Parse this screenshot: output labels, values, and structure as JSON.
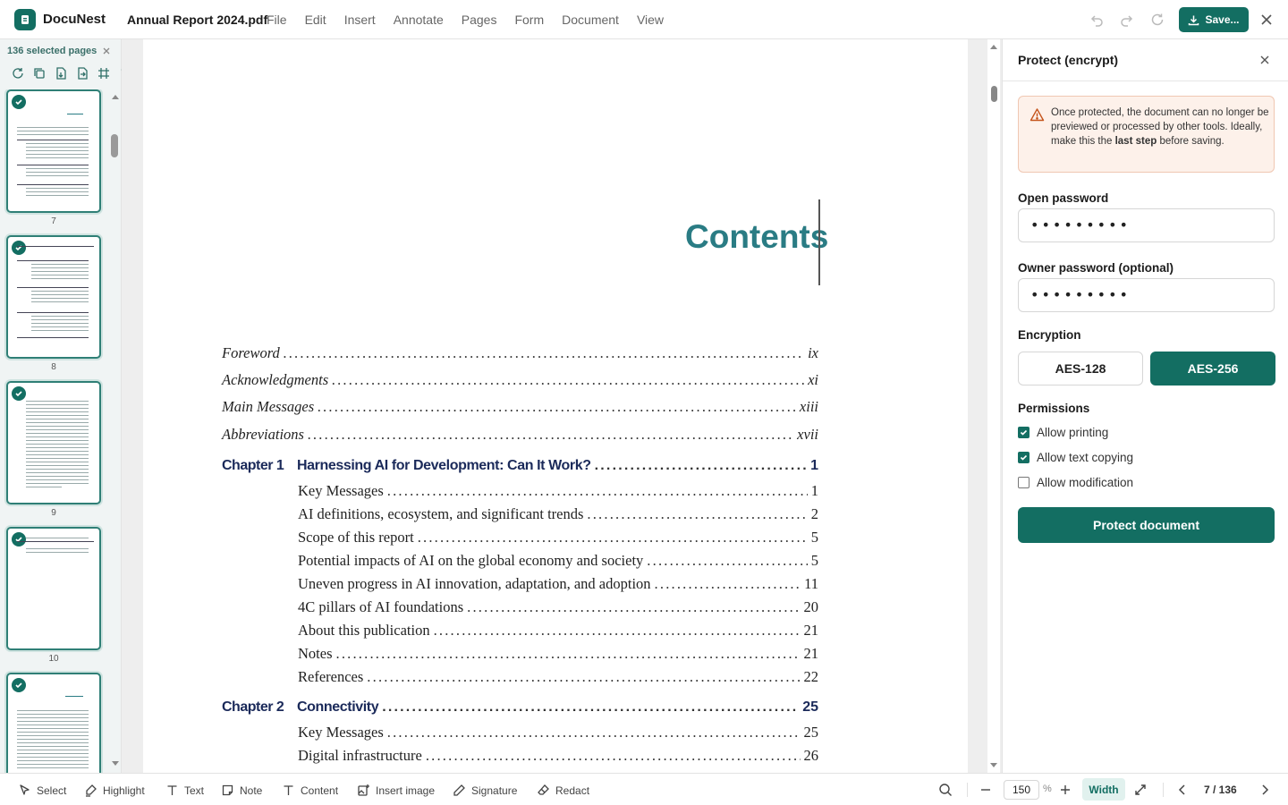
{
  "app": {
    "name": "DocuNest",
    "doc_title": "Annual Report 2024.pdf"
  },
  "menu": [
    "File",
    "Edit",
    "Insert",
    "Annotate",
    "Pages",
    "Form",
    "Document",
    "View"
  ],
  "toolbar": {
    "save_label": "Save..."
  },
  "thumbnails": {
    "selected_label": "136 selected pages",
    "pages": [
      "7",
      "8",
      "9",
      "10"
    ]
  },
  "document": {
    "heading": "Contents",
    "front": [
      {
        "label": "Foreword",
        "page": "ix"
      },
      {
        "label": "Acknowledgments",
        "page": "xi"
      },
      {
        "label": "Main Messages",
        "page": "xiii"
      },
      {
        "label": "Abbreviations",
        "page": "xvii"
      }
    ],
    "chapter1": {
      "num": "Chapter 1",
      "title": "Harnessing AI for Development: Can It Work?",
      "page": "1",
      "items": [
        {
          "label": "Key Messages",
          "page": "1"
        },
        {
          "label": "AI definitions, ecosystem, and significant trends",
          "page": "2"
        },
        {
          "label": "Scope of this report",
          "page": "5"
        },
        {
          "label": "Potential impacts of AI on the global economy and society",
          "page": "5"
        },
        {
          "label": "Uneven progress in AI innovation, adaptation, and adoption",
          "page": "11"
        },
        {
          "label": "4C pillars of AI foundations",
          "page": "20"
        },
        {
          "label": "About this publication",
          "page": "21"
        },
        {
          "label": "Notes",
          "page": "21"
        },
        {
          "label": "References",
          "page": "22"
        }
      ]
    },
    "chapter2": {
      "num": "Chapter 2",
      "title": "Connectivity",
      "page": "25",
      "items": [
        {
          "label": "Key Messages",
          "page": "25"
        },
        {
          "label": "Digital infrastructure",
          "page": "26"
        }
      ]
    }
  },
  "panel": {
    "title": "Protect (encrypt)",
    "warning_pre": "Once protected, the document can no longer be previewed or processed by other tools. Ideally, make this the ",
    "warning_bold": "last step",
    "warning_post": " before saving.",
    "open_password_label": "Open password",
    "open_password_value": "•••••••••",
    "owner_password_label": "Owner password (optional)",
    "owner_password_value": "•••••••••",
    "encryption_label": "Encryption",
    "enc_options": [
      "AES-128",
      "AES-256"
    ],
    "enc_selected": "AES-256",
    "permissions_label": "Permissions",
    "permissions": [
      {
        "label": "Allow printing",
        "checked": true
      },
      {
        "label": "Allow text copying",
        "checked": true
      },
      {
        "label": "Allow modification",
        "checked": false
      }
    ],
    "protect_label": "Protect document"
  },
  "bottom": {
    "tools": [
      "Select",
      "Highlight",
      "Text",
      "Note",
      "Content",
      "Insert image",
      "Signature",
      "Redact"
    ],
    "zoom": "150",
    "zoom_unit": "%",
    "fit_label": "Width",
    "page_indicator": "7 / 136"
  },
  "colors": {
    "accent": "#136e62",
    "heading": "#2a7c84",
    "chapter": "#1b2a5a",
    "warning_bg": "#fdf1ea"
  }
}
